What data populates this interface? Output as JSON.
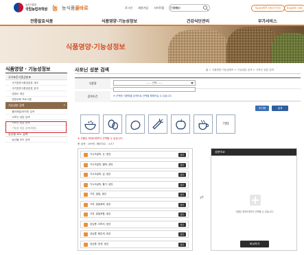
{
  "header": {
    "gov_sub": "농촌진흥청",
    "gov_name": "국립농업과학원",
    "brand_mark": "농",
    "brand_prefix": "농식품",
    "brand_accent": "올바로",
    "links": [
      "로그인",
      "회원가입",
      "사이트맵",
      "전체메뉴"
    ],
    "search_placeholder": "검색어",
    "api_button": "OpenAPI 서비스안내",
    "eng_button": "English site"
  },
  "gnb": [
    "전통발효식품",
    "식품영양·기능성정보",
    "건강식단관리",
    "부가서비스"
  ],
  "banner": {
    "title": "식품영양·기능성정보"
  },
  "sidebar": {
    "title": "식품영양 · 기능성정보",
    "items": [
      {
        "type": "grp",
        "label": "국가표준식품성분표"
      },
      {
        "type": "sub",
        "label": "· 국가표준식품성분표 개요"
      },
      {
        "type": "sub",
        "label": "· 국가표준식품성분표 검색"
      },
      {
        "type": "sub",
        "label": "· 영양소 계산"
      },
      {
        "type": "sub",
        "label": "· 영양교육 프로그램"
      },
      {
        "type": "active",
        "label": "기능성분 검색"
      },
      {
        "type": "sub",
        "label": "· 폴리페놀/비타민 검색"
      },
      {
        "type": "sub",
        "label": "· 사포닌 성분 검색"
      },
      {
        "type": "sub",
        "label": "· 사포닌 성분 검색"
      },
      {
        "type": "sub",
        "label": "· 기능성 성분 검색(특정)",
        "small": true
      },
      {
        "type": "grp2",
        "label": "농산물 요도 검색"
      },
      {
        "type": "sub",
        "label": "· 농산물 요도 검색"
      }
    ]
  },
  "main": {
    "page_title": "사포닌 성분 검색",
    "breadcrumb": "홈 > 식품영양·기능성정보 > 기능성분 검색 > 사포닌 성분 검색",
    "form": {
      "row1_label": "식품명",
      "select_value": "------ 선택 ------",
      "row2_label": "검색조건",
      "condition_note": "※ 선택한 식품명을 검색어로 선택을 해제하실 수 있습니다."
    },
    "buttons": {
      "reset": "초기화",
      "search": "검색"
    },
    "category_last": "기타",
    "warning": "※ 식품은 최대5개까지 선택할 수 있습니다.",
    "count": "총 검색 : 169건, 페이지수 : 1/17"
  },
  "list_items": [
    "가시오갈피, 순, 생것",
    "가시오갈피, 열매, 생것",
    "가시오갈피, 잎, 생것",
    "가시오갈피, 줄기, 생것",
    "가지, 껍질, 생것",
    "가지, 껍질제외, 생것",
    "가지, 껍질포함, 생것",
    "강낭콩, 꼬투리, 생것",
    "강낭콩, 붉은색, 생것",
    "강낭콩, 흰색, 생것"
  ],
  "add_button": "담기",
  "compare": {
    "header": "성분비교",
    "note": "식품은 최대5개까지 선택할 수 있습니다.",
    "button": "비교하기"
  },
  "arrows": "⇄",
  "colors": {
    "accent": "#e07a2a",
    "sidebar_active": "#8a6a4b",
    "highlight": "#d2232a",
    "button_blue": "#2f5e9e"
  }
}
